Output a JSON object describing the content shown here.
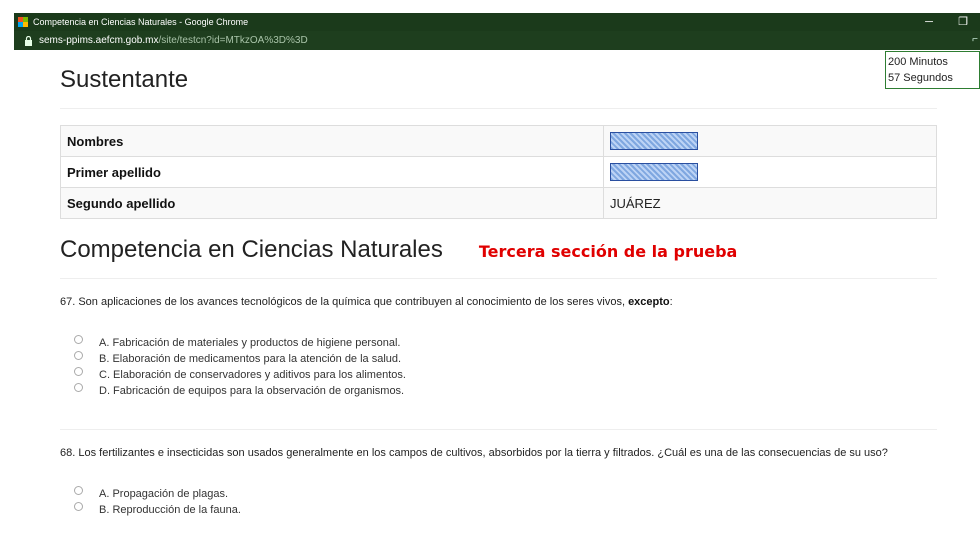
{
  "window": {
    "title": "Competencia en Ciencias Naturales - Google Chrome",
    "url_domain": "sems-ppims.aefcm.gob.mx",
    "url_path": "/site/testcn?id=MTkzOA%3D%3D",
    "minimize": "─",
    "restore": "❐",
    "key_glyph": "⌐"
  },
  "timer": {
    "minutes": "200 Minutos",
    "seconds": "57 Segundos"
  },
  "sustentante": {
    "heading": "Sustentante",
    "rows": [
      {
        "label": "Nombres",
        "value": ""
      },
      {
        "label": "Primer apellido",
        "value": ""
      },
      {
        "label": "Segundo apellido",
        "value": "JUÁREZ"
      }
    ]
  },
  "section": {
    "heading": "Competencia en Ciencias Naturales",
    "annotation": "Tercera sección de la prueba"
  },
  "questions": [
    {
      "text_before": "67. Son aplicaciones de los avances tecnológicos de la química que contribuyen al conocimiento de los seres vivos, ",
      "text_bold": "excepto",
      "text_after": ":",
      "options": [
        "A. Fabricación de materiales y productos de higiene personal.",
        "B. Elaboración de medicamentos para la atención de la salud.",
        "C. Elaboración de conservadores y aditivos para los alimentos.",
        "D. Fabricación de equipos para la observación de organismos."
      ]
    },
    {
      "text_before": "68. Los fertilizantes e insecticidas son usados generalmente en los campos de cultivos, absorbidos por la tierra y filtrados. ¿Cuál es una de las consecuencias de su uso?",
      "options": [
        "A. Propagación de plagas.",
        "B. Reproducción de la fauna."
      ]
    }
  ],
  "colors": {
    "titlebar": "#1b3a1b",
    "accent_red": "#e00000",
    "timer_border": "#2e7d32"
  }
}
